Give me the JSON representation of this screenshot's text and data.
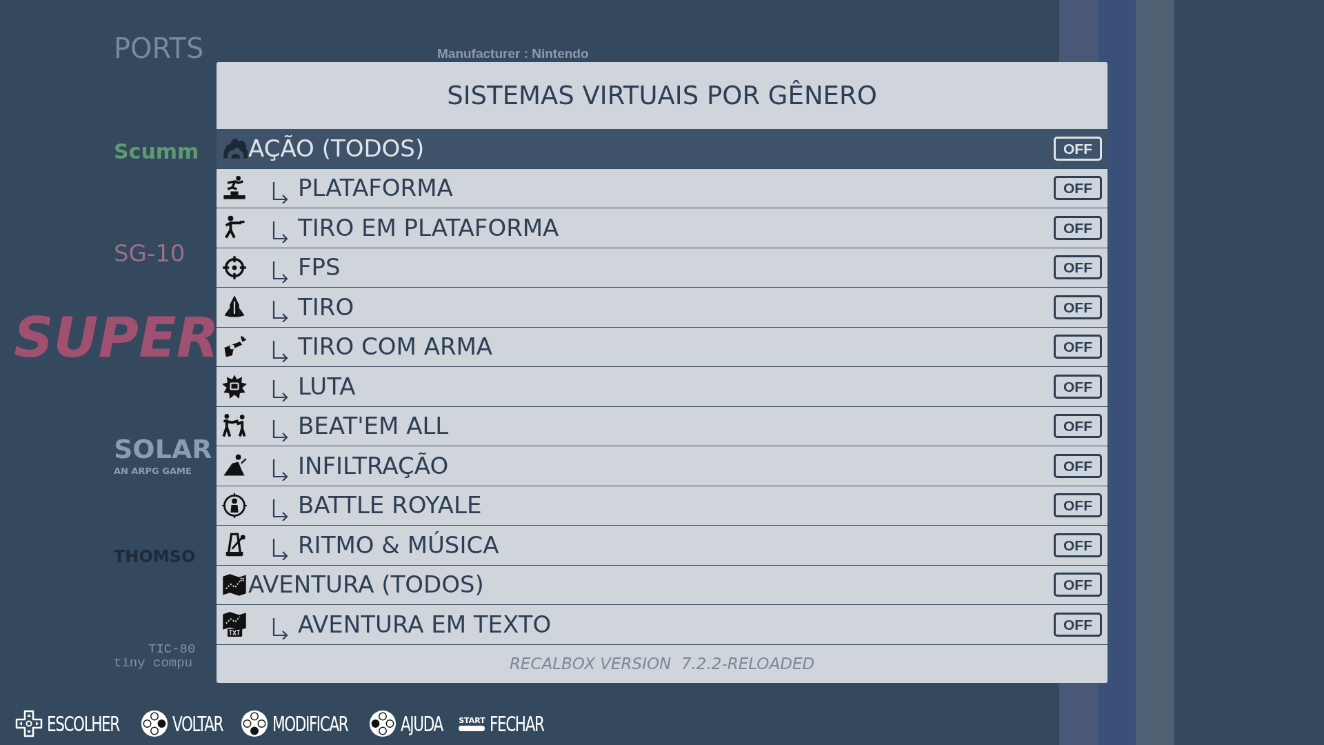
{
  "background": {
    "logos": [
      "PORTS",
      "Scumm",
      "SG-10",
      "SUPER",
      "SOLAR",
      "AN ARPG GAME",
      "THOMSO",
      "TIC-80",
      "tiny compu"
    ],
    "info": "Manufacturer : Nintendo"
  },
  "dialog": {
    "title": "SISTEMAS VIRTUAIS POR GÊNERO",
    "items": [
      {
        "kind": "parent",
        "label": "AÇÃO (TODOS)",
        "switch": "OFF",
        "on": false,
        "selected": true
      },
      {
        "kind": "child",
        "label": "PLATAFORMA",
        "switch": "OFF",
        "on": false,
        "selected": false
      },
      {
        "kind": "child",
        "label": "TIRO EM PLATAFORMA",
        "switch": "OFF",
        "on": false,
        "selected": false
      },
      {
        "kind": "child",
        "label": "FPS",
        "switch": "OFF",
        "on": false,
        "selected": false
      },
      {
        "kind": "child",
        "label": "TIRO",
        "switch": "OFF",
        "on": false,
        "selected": false
      },
      {
        "kind": "child",
        "label": "TIRO COM ARMA",
        "switch": "OFF",
        "on": false,
        "selected": false
      },
      {
        "kind": "child",
        "label": "LUTA",
        "switch": "OFF",
        "on": false,
        "selected": false
      },
      {
        "kind": "child",
        "label": "BEAT'EM ALL",
        "switch": "OFF",
        "on": false,
        "selected": false
      },
      {
        "kind": "child",
        "label": "INFILTRAÇÃO",
        "switch": "OFF",
        "on": false,
        "selected": false
      },
      {
        "kind": "child",
        "label": "BATTLE ROYALE",
        "switch": "OFF",
        "on": false,
        "selected": false
      },
      {
        "kind": "child",
        "label": "RITMO & MÚSICA",
        "switch": "OFF",
        "on": false,
        "selected": false
      },
      {
        "kind": "parent",
        "label": "AVENTURA (TODOS)",
        "switch": "OFF",
        "on": false,
        "selected": false
      },
      {
        "kind": "child",
        "label": "AVENTURA EM TEXTO",
        "switch": "OFF",
        "on": false,
        "selected": false
      }
    ],
    "footer": "RECALBOX VERSION  7.2.2-RELOADED"
  },
  "help_bar": [
    {
      "kind": "dpad",
      "label": "ESCOLHER"
    },
    {
      "kind": "button-right",
      "label": "VOLTAR"
    },
    {
      "kind": "button-bottom",
      "label": "MODIFICAR"
    },
    {
      "kind": "button-left",
      "label": "AJUDA"
    },
    {
      "kind": "start",
      "label": "FECHAR",
      "badge": "START"
    }
  ]
}
